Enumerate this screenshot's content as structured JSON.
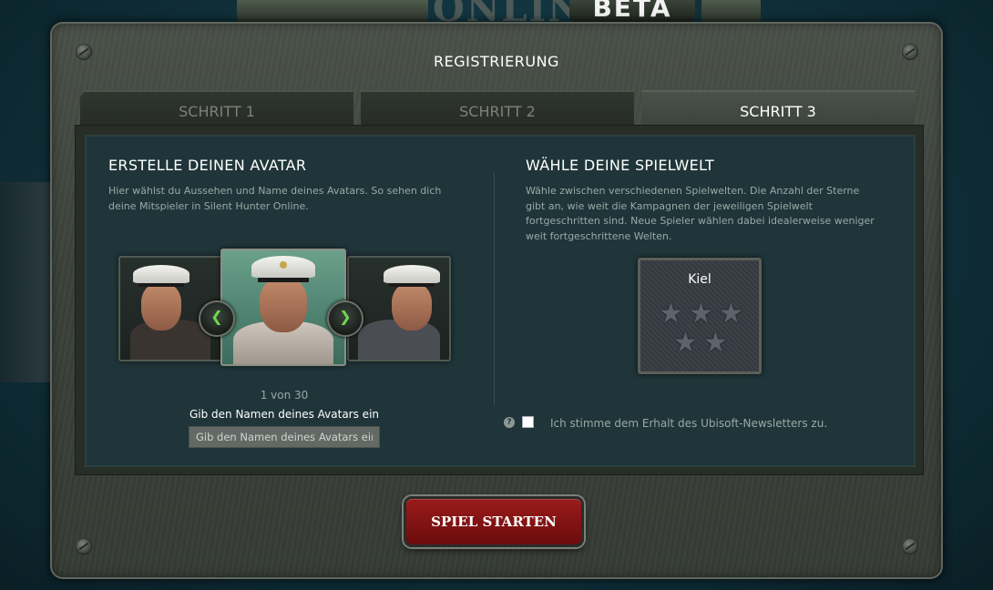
{
  "logo": {
    "text": "ONLINE",
    "beta": "BETA"
  },
  "dialog": {
    "title": "REGISTRIERUNG",
    "tabs": [
      {
        "label": "SCHRITT 1",
        "active": false
      },
      {
        "label": "SCHRITT 2",
        "active": false
      },
      {
        "label": "SCHRITT 3",
        "active": true
      }
    ]
  },
  "avatar": {
    "heading": "ERSTELLE DEINEN AVATAR",
    "description": "Hier wählst du Aussehen und Name deines Avatars. So sehen dich deine Mitspieler in Silent Hunter Online.",
    "counter": "1 von 30",
    "name_label": "Gib den Namen deines Avatars ein",
    "name_placeholder": "Gib den Namen deines Avatars ein",
    "name_value": ""
  },
  "world": {
    "heading": "WÄHLE DEINE SPIELWELT",
    "description": "Wähle zwischen verschiedenen Spielwelten. Die Anzahl der Sterne gibt an, wie weit die Kampagnen der jeweiligen Spielwelt fortgeschritten sind. Neue Spieler wählen dabei idealerweise weniger weit fortgeschrittene Welten.",
    "card": {
      "name": "Kiel",
      "stars": 5
    }
  },
  "newsletter": {
    "help_icon": "?",
    "checked": false,
    "label": "Ich stimme dem Erhalt des Ubisoft-Newsletters zu."
  },
  "start_button": {
    "label": "SPIEL STARTEN",
    "color": "#8b1515"
  }
}
